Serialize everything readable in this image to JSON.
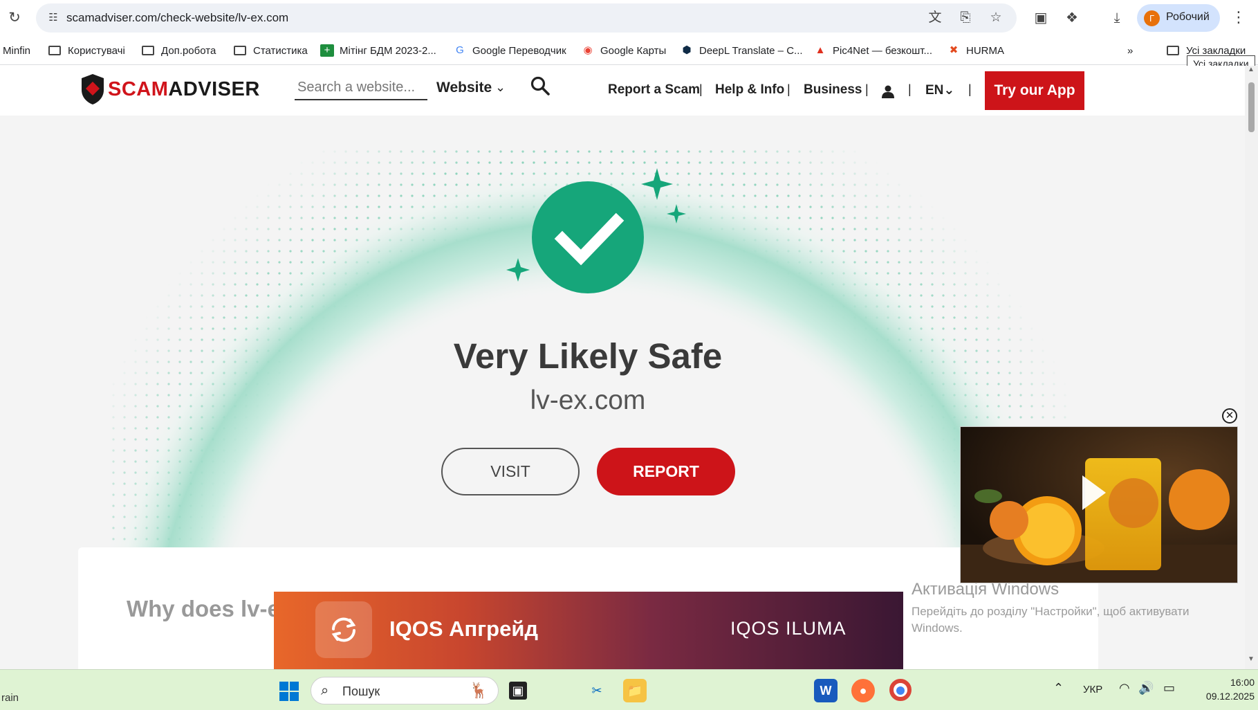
{
  "browser": {
    "url": "scamadviser.com/check-website/lv-ex.com",
    "profile_initial": "Г",
    "profile_name": "Робочий"
  },
  "bookmarks": [
    {
      "label": "Minfin",
      "icon": "none"
    },
    {
      "label": "Користувачі",
      "icon": "folder-icon"
    },
    {
      "label": "Доп.робота",
      "icon": "folder-icon"
    },
    {
      "label": "Статистика",
      "icon": "folder-icon"
    },
    {
      "label": "Мітінг БДМ 2023-2...",
      "icon": "sheets-icon"
    },
    {
      "label": "Google Переводчик",
      "icon": "translate-icon"
    },
    {
      "label": "Google Карты",
      "icon": "maps-icon"
    },
    {
      "label": "DeepL Translate – C...",
      "icon": "deepl-icon"
    },
    {
      "label": "Pic4Net — безкошт...",
      "icon": "pic4net-icon"
    },
    {
      "label": "HURMA",
      "icon": "hurma-icon"
    }
  ],
  "all_bookmarks": "Усі закладки",
  "tooltip": "Усі закладки",
  "site": {
    "logo_scam": "SCAM",
    "logo_adviser": "ADVISER",
    "search_placeholder": "Search a website...",
    "search_type": "Website",
    "nav": [
      "Report a Scam",
      "Help & Info",
      "Business"
    ],
    "lang": "EN",
    "cta": "Try our App"
  },
  "result": {
    "verdict": "Very Likely Safe",
    "domain": "lv-ex.com",
    "visit": "VISIT",
    "report": "REPORT",
    "why_heading": "Why does lv-ex"
  },
  "ad": {
    "title": "IQOS Апгрейд",
    "brand": "IQOS ILUMA"
  },
  "activation": {
    "title": "Активація Windows",
    "subtitle": "Перейдіть до розділу \"Настройки\", щоб активувати Windows."
  },
  "taskbar": {
    "weather": "rain",
    "search_placeholder": "Пошук",
    "lang": "УКР",
    "time": "16:00",
    "date": "09.12.2025"
  },
  "colors": {
    "brand_red": "#cd1419",
    "safe_green": "#16a67a"
  }
}
